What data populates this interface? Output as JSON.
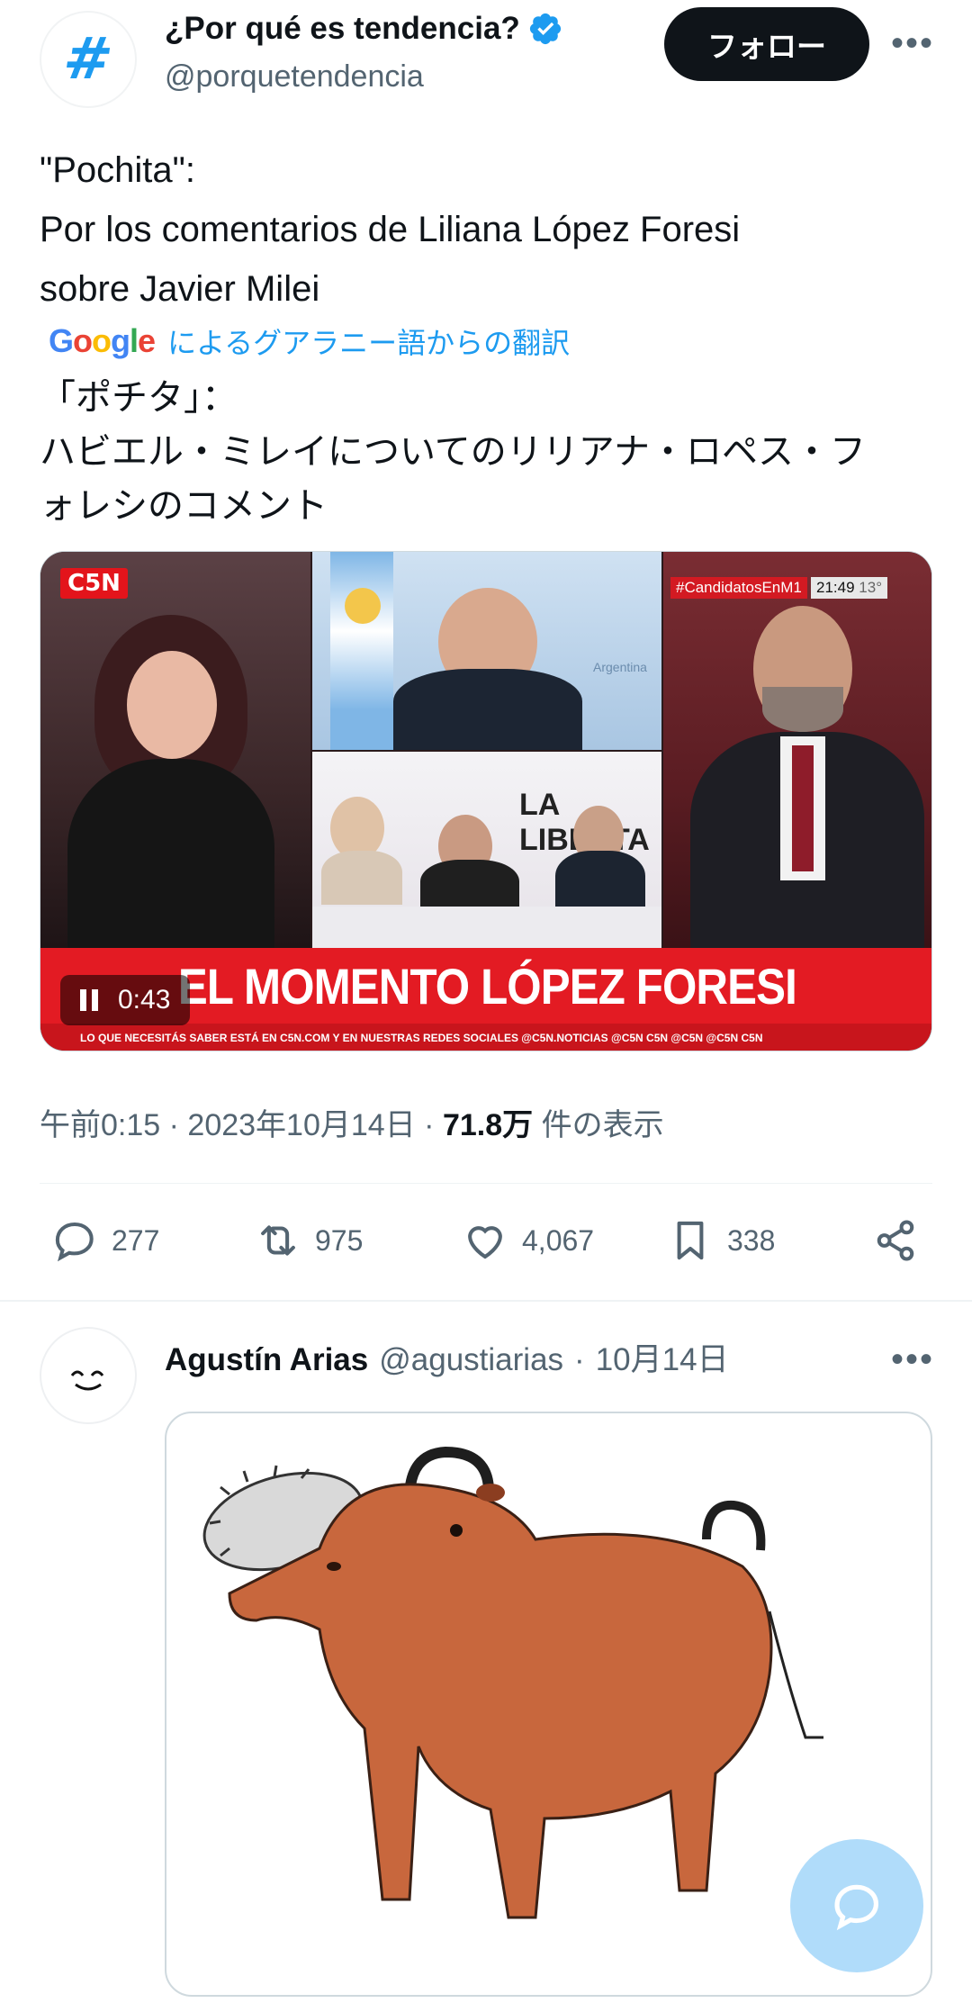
{
  "author": {
    "avatar_glyph": "#",
    "display_name": "¿Por qué es tendencia?",
    "handle": "@porquetendencia",
    "follow_label": "フォロー"
  },
  "tweet": {
    "text_line1": "\"Pochita\":",
    "text_line2": "Por los comentarios de Liliana López Foresi",
    "text_line3": "sobre Javier Milei",
    "google_label": "Google",
    "translate_label": "によるグアラニー語からの翻訳",
    "translated_line1": "「ポチタ」：",
    "translated_line2": "ハビエル・ミレイについてのリリアナ・ロペス・フ",
    "translated_line3": "ォレシのコメント"
  },
  "video": {
    "channel_logo": "C5N",
    "hashtag": "#CandidatosEnM1",
    "clock": "21:49",
    "temperature": "13°",
    "headline": "EL MOMENTO LÓPEZ FORESI",
    "ticker": "LO QUE NECESITÁS SABER ESTÁ EN C5N.COM Y EN NUESTRAS REDES SOCIALES  @C5N.NOTICIAS  @C5N  C5N  @C5N  @C5N  C5N",
    "sign_text": "Argentina",
    "banner_text": "LA LIBERTA",
    "timestamp": "0:43"
  },
  "meta": {
    "time": "午前0:15",
    "sep1": "·",
    "date": "2023年10月14日",
    "sep2": "·",
    "views_count": "71.8万",
    "views_label": "件の表示"
  },
  "actions": {
    "replies": "277",
    "retweets": "975",
    "likes": "4,067",
    "bookmarks": "338"
  },
  "reply": {
    "name": "Agustín Arias",
    "handle": "@agustiarias",
    "sep": "·",
    "date": "10月14日"
  },
  "colors": {
    "accent": "#1d9bf0",
    "text": "#0f1419",
    "muted": "#536471",
    "news_red": "#e31b23"
  }
}
